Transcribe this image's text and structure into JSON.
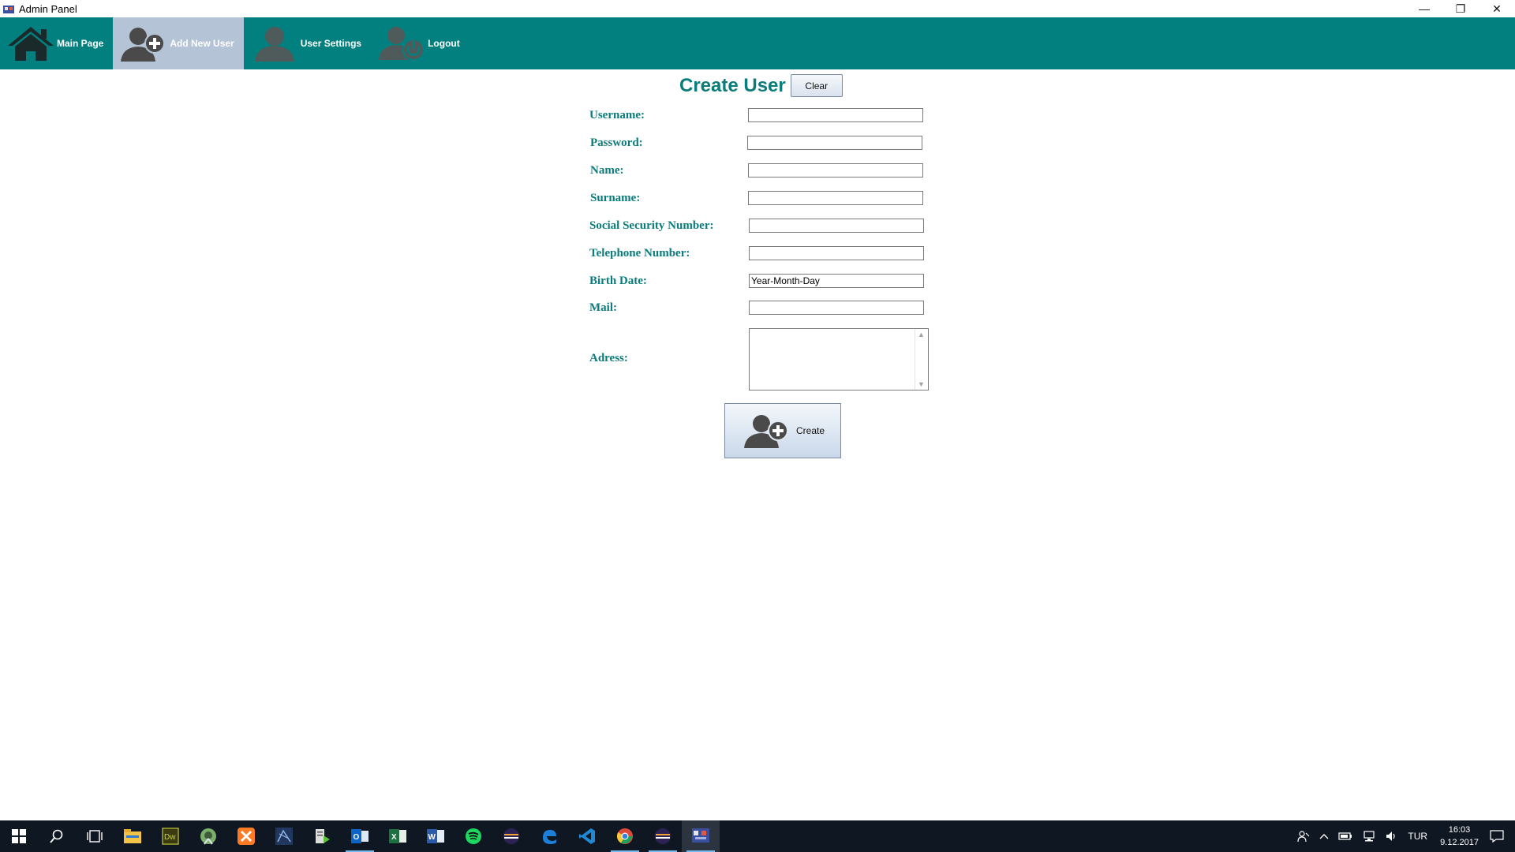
{
  "window": {
    "title": "Admin Panel",
    "controls": {
      "minimize": "—",
      "restore": "❐",
      "close": "✕"
    }
  },
  "nav": {
    "items": [
      {
        "label": "Main Page",
        "icon": "home-icon"
      },
      {
        "label": "Add New User",
        "icon": "add-user-icon",
        "active": true
      },
      {
        "label": "User Settings",
        "icon": "user-icon"
      },
      {
        "label": "Logout",
        "icon": "logout-icon"
      }
    ]
  },
  "form": {
    "title": "Create User",
    "clear_label": "Clear",
    "fields": {
      "username": {
        "label": "Username:",
        "value": ""
      },
      "password": {
        "label": "Password:",
        "value": ""
      },
      "name": {
        "label": "Name:",
        "value": ""
      },
      "surname": {
        "label": "Surname:",
        "value": ""
      },
      "ssn": {
        "label": "Social Security Number:",
        "value": ""
      },
      "telephone": {
        "label": "Telephone Number:",
        "value": ""
      },
      "birth_date": {
        "label": "Birth Date:",
        "value": "Year-Month-Day"
      },
      "mail": {
        "label": "Mail:",
        "value": ""
      },
      "address": {
        "label": "Adress:",
        "value": ""
      }
    },
    "create_label": "Create"
  },
  "taskbar": {
    "apps": [
      "start-icon",
      "search-icon",
      "task-view-icon",
      "file-explorer-icon",
      "dreamweaver-icon",
      "android-studio-icon",
      "xampp-icon",
      "netbeans-icon",
      "server-icon",
      "outlook-icon",
      "excel-icon",
      "word-icon",
      "spotify-icon",
      "eclipse-icon",
      "edge-icon",
      "vscode-icon",
      "chrome-icon",
      "eclipse-icon-2",
      "admin-panel-app-icon"
    ],
    "tray": {
      "language": "TUR",
      "time": "16:03",
      "date": "9.12.2017"
    }
  },
  "colors": {
    "nav_bg": "#028080",
    "nav_active": "#b5c3d6",
    "label": "#0b7b7b",
    "taskbar": "#0f1722"
  }
}
